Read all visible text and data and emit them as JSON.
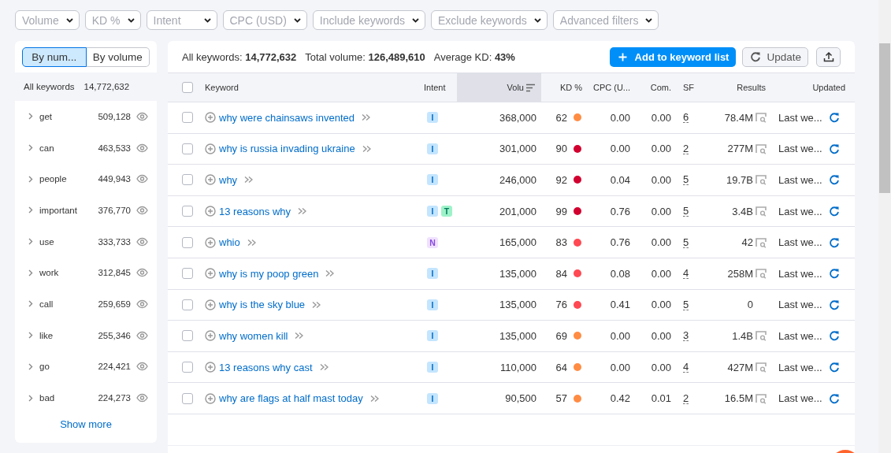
{
  "filters": [
    {
      "label": "Volume"
    },
    {
      "label": "KD %"
    },
    {
      "label": "Intent"
    },
    {
      "label": "CPC (USD)"
    },
    {
      "label": "Include keywords"
    },
    {
      "label": "Exclude keywords"
    },
    {
      "label": "Advanced filters"
    }
  ],
  "sidebar": {
    "toggle": [
      {
        "label": "By num...",
        "selected": true
      },
      {
        "label": "By volume",
        "selected": false
      }
    ],
    "all": {
      "label": "All keywords",
      "count": "14,772,632"
    },
    "groups": [
      {
        "label": "get",
        "count": "509,128",
        "expanded": false
      },
      {
        "label": "can",
        "count": "463,533",
        "expanded": false
      },
      {
        "label": "people",
        "count": "449,943",
        "expanded": false
      },
      {
        "label": "important",
        "count": "376,770",
        "expanded": false
      },
      {
        "label": "use",
        "count": "333,733",
        "expanded": false
      },
      {
        "label": "work",
        "count": "312,845",
        "expanded": false
      },
      {
        "label": "call",
        "count": "259,659",
        "expanded": false
      },
      {
        "label": "like",
        "count": "255,346",
        "expanded": false
      },
      {
        "label": "go",
        "count": "224,421",
        "expanded": false
      },
      {
        "label": "bad",
        "count": "224,273",
        "expanded": false
      }
    ],
    "show_more": "Show more"
  },
  "summary": [
    "All keywords: **14,772,632**",
    "Total volume: **126,489,610**",
    "Average KD: **43%**"
  ],
  "actions": {
    "add": "Add to keyword list",
    "update": "Update"
  },
  "table": {
    "header_checked": false,
    "columns": [
      {
        "label": "Keyword",
        "sorted": false
      },
      {
        "label": "Intent",
        "sorted": false
      },
      {
        "label": "Volu",
        "sorted": true
      },
      {
        "label": "KD %",
        "sorted": false
      },
      {
        "label": "CPC (U...",
        "sorted": false
      },
      {
        "label": "Com.",
        "sorted": false
      },
      {
        "label": "SF",
        "sorted": false
      },
      {
        "label": "Results",
        "sorted": false
      },
      {
        "label": "Updated",
        "sorted": false
      }
    ],
    "rows": [
      {
        "checked": false,
        "keyword": "why were chainsaws invented",
        "intents": [
          {
            "label": "I",
            "color": "#c4e5fe"
          }
        ],
        "volume": "368,000",
        "kd": "62",
        "color": "#ff8c43",
        "cpc": "0.00",
        "com": "0.00",
        "sf": "6",
        "results": "78.4M",
        "serp_preview": true,
        "updated": "Last we..."
      },
      {
        "checked": false,
        "keyword": "why is russia invading ukraine",
        "intents": [
          {
            "label": "I",
            "color": "#c4e5fe"
          }
        ],
        "volume": "301,000",
        "kd": "90",
        "color": "#d1002f",
        "cpc": "0.00",
        "com": "0.00",
        "sf": "2",
        "results": "277M",
        "serp_preview": true,
        "updated": "Last we..."
      },
      {
        "checked": false,
        "keyword": "why",
        "intents": [
          {
            "label": "I",
            "color": "#c4e5fe"
          }
        ],
        "volume": "246,000",
        "kd": "92",
        "color": "#d1002f",
        "cpc": "0.04",
        "com": "0.00",
        "sf": "5",
        "results": "19.7B",
        "serp_preview": true,
        "updated": "Last we..."
      },
      {
        "checked": false,
        "keyword": "13 reasons why",
        "intents": [
          {
            "label": "I",
            "color": "#c4e5fe"
          },
          {
            "label": "T",
            "color": "#9ef2c9"
          }
        ],
        "volume": "201,000",
        "kd": "99",
        "color": "#d1002f",
        "cpc": "0.76",
        "com": "0.00",
        "sf": "5",
        "results": "3.4B",
        "serp_preview": true,
        "updated": "Last we..."
      },
      {
        "checked": false,
        "keyword": "whio",
        "intents": [
          {
            "label": "N",
            "color": "#f0e1ff"
          }
        ],
        "volume": "165,000",
        "kd": "83",
        "color": "#ff4953",
        "cpc": "0.76",
        "com": "0.00",
        "sf": "5",
        "results": "42",
        "serp_preview": true,
        "updated": "Last we..."
      },
      {
        "checked": false,
        "keyword": "why is my poop green",
        "intents": [
          {
            "label": "I",
            "color": "#c4e5fe"
          }
        ],
        "volume": "135,000",
        "kd": "84",
        "color": "#ff4953",
        "cpc": "0.08",
        "com": "0.00",
        "sf": "4",
        "results": "258M",
        "serp_preview": true,
        "updated": "Last we..."
      },
      {
        "checked": false,
        "keyword": "why is the sky blue",
        "intents": [
          {
            "label": "I",
            "color": "#c4e5fe"
          }
        ],
        "volume": "135,000",
        "kd": "76",
        "color": "#ff4953",
        "cpc": "0.41",
        "com": "0.00",
        "sf": "5",
        "results": "0",
        "serp_preview": false,
        "updated": "Last we..."
      },
      {
        "checked": false,
        "keyword": "why women kill",
        "intents": [
          {
            "label": "I",
            "color": "#c4e5fe"
          }
        ],
        "volume": "135,000",
        "kd": "69",
        "color": "#ff8c43",
        "cpc": "0.00",
        "com": "0.00",
        "sf": "3",
        "results": "1.4B",
        "serp_preview": true,
        "updated": "Last we..."
      },
      {
        "checked": false,
        "keyword": "13 reasons why cast",
        "intents": [
          {
            "label": "I",
            "color": "#c4e5fe"
          }
        ],
        "volume": "110,000",
        "kd": "64",
        "color": "#ff8c43",
        "cpc": "0.00",
        "com": "0.00",
        "sf": "4",
        "results": "427M",
        "serp_preview": true,
        "updated": "Last we..."
      },
      {
        "checked": false,
        "keyword": "why are flags at half mast today",
        "intents": [
          {
            "label": "I",
            "color": "#c4e5fe"
          }
        ],
        "volume": "90,500",
        "kd": "57",
        "color": "#ff8c43",
        "cpc": "0.42",
        "com": "0.01",
        "sf": "2",
        "results": "16.5M",
        "serp_preview": true,
        "updated": "Last we..."
      }
    ]
  }
}
